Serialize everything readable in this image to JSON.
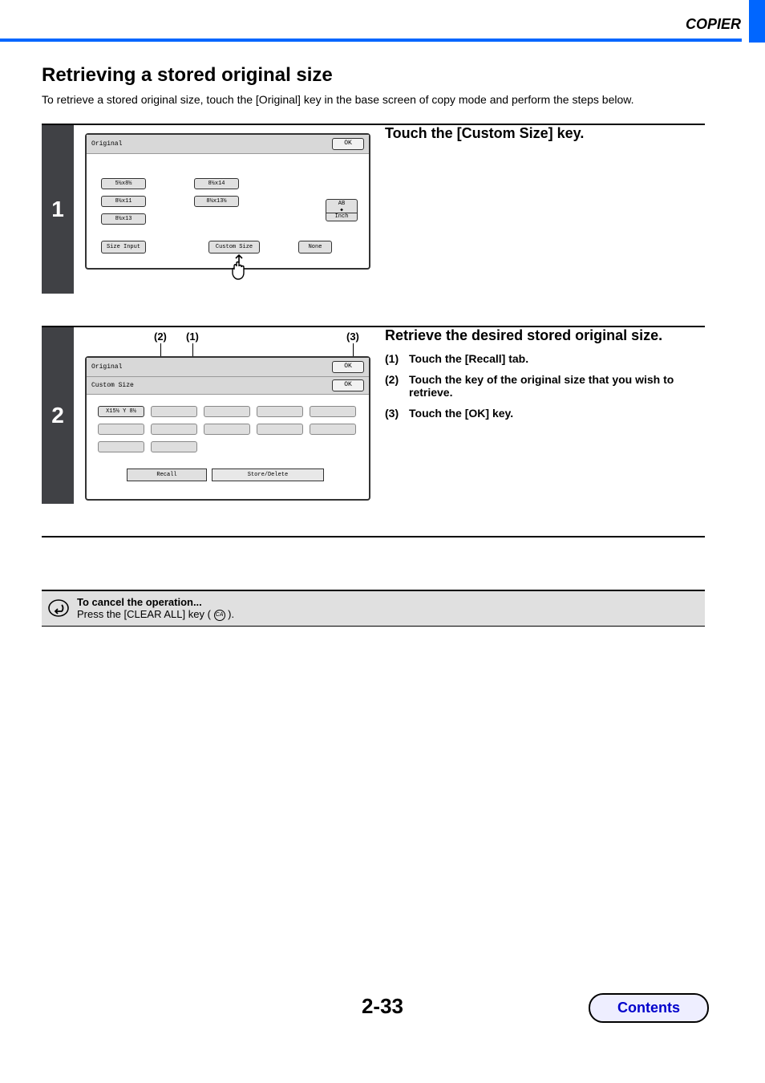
{
  "header": {
    "section": "COPIER"
  },
  "title": "Retrieving a stored original size",
  "intro": "To retrieve a stored original size, touch the [Original] key in the base screen of copy mode and perform the steps below.",
  "step1": {
    "number": "1",
    "desc_title": "Touch the [Custom Size] key.",
    "panel": {
      "title": "Original",
      "ok": "OK",
      "sizes_col1": [
        "5½x8½",
        "8½x11",
        "8½x13"
      ],
      "sizes_col2": [
        "8½x14",
        "8½x13½"
      ],
      "ab": "AB",
      "inch": "Inch",
      "size_input": "Size Input",
      "custom_size": "Custom Size",
      "none": "None"
    }
  },
  "step2": {
    "number": "2",
    "desc_title": "Retrieve the desired stored original size.",
    "steps": [
      {
        "n": "(1)",
        "t": "Touch the [Recall] tab."
      },
      {
        "n": "(2)",
        "t": "Touch the key of the original size that you wish to retrieve."
      },
      {
        "n": "(3)",
        "t": "Touch the [OK] key."
      }
    ],
    "ann": {
      "a1": "(1)",
      "a2": "(2)",
      "a3": "(3)"
    },
    "panel": {
      "title": "Original",
      "ok1": "OK",
      "sub_title": "Custom Size",
      "ok2": "OK",
      "active_slot": "X15½ Y 8½",
      "recall": "Recall",
      "store": "Store/Delete"
    }
  },
  "note": {
    "title": "To cancel the operation...",
    "body_before": "Press the [CLEAR ALL] key (",
    "body_ca": "CA",
    "body_after": ")."
  },
  "page_number": "2-33",
  "contents": "Contents"
}
